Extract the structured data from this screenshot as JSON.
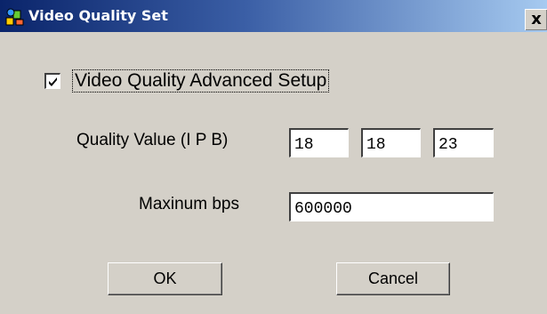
{
  "window": {
    "title": "Video Quality Set",
    "close_label": "x",
    "icon": "app-icon"
  },
  "advanced_setup": {
    "checked": true,
    "label": "Video Quality Advanced  Setup"
  },
  "quality": {
    "label": "Quality Value (I P B)",
    "i_value": "18",
    "p_value": "18",
    "b_value": "23"
  },
  "bitrate": {
    "label": "Maxinum bps",
    "value": "600000"
  },
  "buttons": {
    "ok_label": "OK",
    "cancel_label": "Cancel"
  },
  "colors": {
    "titlebar_start": "#0a246a",
    "titlebar_end": "#a6caf0",
    "dialog_background": "#d4d0c8"
  }
}
